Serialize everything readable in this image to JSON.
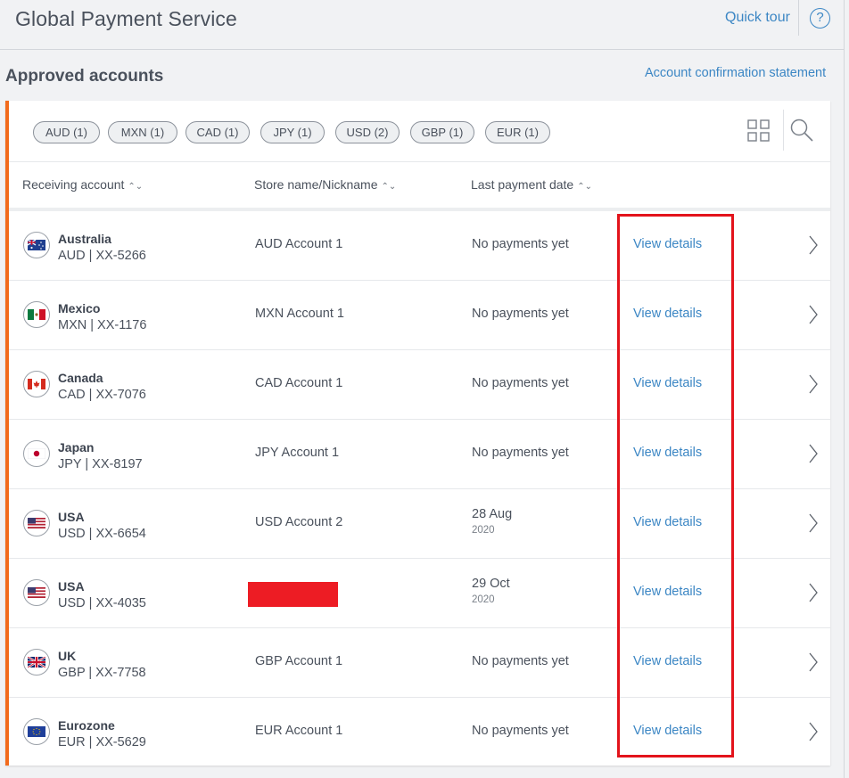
{
  "header": {
    "title": "Global Payment Service",
    "quick_tour": "Quick tour",
    "help_glyph": "?"
  },
  "section": {
    "title": "Approved accounts",
    "statement_link": "Account confirmation statement"
  },
  "filters": [
    {
      "label": "AUD (1)"
    },
    {
      "label": "MXN (1)"
    },
    {
      "label": "CAD (1)"
    },
    {
      "label": "JPY (1)"
    },
    {
      "label": "USD (2)"
    },
    {
      "label": "GBP (1)"
    },
    {
      "label": "EUR (1)"
    }
  ],
  "toolbar": {
    "grid_icon": "grid-view-icon",
    "search_icon": "search-icon"
  },
  "table": {
    "columns": [
      "Receiving account",
      "Store name/Nickname",
      "Last payment date"
    ],
    "sort_glyph": "⌃⌄",
    "rows": [
      {
        "flag": "AU",
        "country": "Australia",
        "account": "AUD | XX-5266",
        "store": "AUD Account 1",
        "date": "No payments yet",
        "year": "",
        "link": "View details"
      },
      {
        "flag": "MX",
        "country": "Mexico",
        "account": "MXN | XX-1176",
        "store": "MXN Account 1",
        "date": "No payments yet",
        "year": "",
        "link": "View details"
      },
      {
        "flag": "CA",
        "country": "Canada",
        "account": "CAD | XX-7076",
        "store": "CAD Account 1",
        "date": "No payments yet",
        "year": "",
        "link": "View details"
      },
      {
        "flag": "JP",
        "country": "Japan",
        "account": "JPY | XX-8197",
        "store": "JPY Account 1",
        "date": "No payments yet",
        "year": "",
        "link": "View details"
      },
      {
        "flag": "US",
        "country": "USA",
        "account": "USD | XX-6654",
        "store": "USD Account 2",
        "date": "28 Aug",
        "year": "2020",
        "link": "View details"
      },
      {
        "flag": "US",
        "country": "USA",
        "account": "USD | XX-4035",
        "store": "",
        "redacted": true,
        "date": "29 Oct",
        "year": "2020",
        "link": "View details"
      },
      {
        "flag": "GB",
        "country": "UK",
        "account": "GBP | XX-7758",
        "store": "GBP Account 1",
        "date": "No payments yet",
        "year": "",
        "link": "View details"
      },
      {
        "flag": "EU",
        "country": "Eurozone",
        "account": "EUR | XX-5629",
        "store": "EUR Account 1",
        "date": "No payments yet",
        "year": "",
        "link": "View details"
      }
    ]
  },
  "colors": {
    "accent_orange": "#f26b1d",
    "link_blue": "#3b86c4",
    "highlight_red": "#e3131b",
    "redaction_red": "#ed1c24"
  }
}
